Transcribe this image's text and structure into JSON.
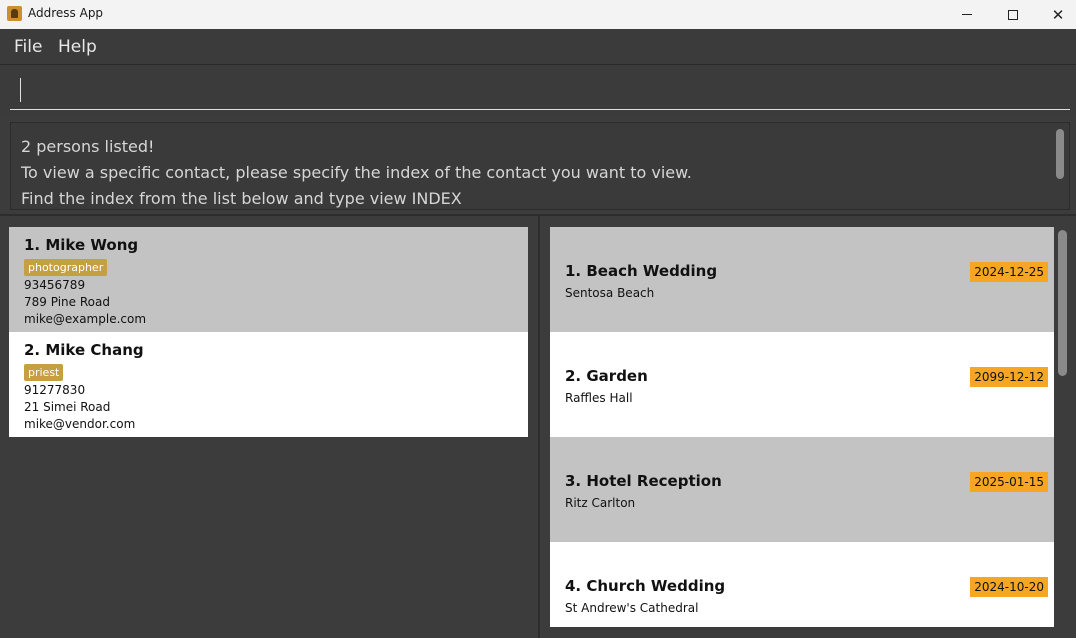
{
  "window": {
    "title": "Address App"
  },
  "menu": {
    "file": "File",
    "help": "Help"
  },
  "command": {
    "value": "",
    "placeholder": ""
  },
  "result": {
    "lines": [
      "2 persons listed!",
      "To view a specific contact, please specify the index of the contact you want to view.",
      "Find the index from the list below and type view INDEX"
    ]
  },
  "persons": [
    {
      "name": "1.  Mike Wong",
      "tag": "photographer",
      "phone": "93456789",
      "address": "789 Pine Road",
      "email": "mike@example.com"
    },
    {
      "name": "2.  Mike Chang",
      "tag": "priest",
      "phone": "91277830",
      "address": "21 Simei Road",
      "email": "mike@vendor.com"
    }
  ],
  "events": [
    {
      "name": "1.  Beach Wedding",
      "location": "Sentosa Beach",
      "date": "2024-12-25"
    },
    {
      "name": "2.  Garden",
      "location": "Raffles Hall",
      "date": "2099-12-12"
    },
    {
      "name": "3.  Hotel Reception",
      "location": "Ritz Carlton",
      "date": "2025-01-15"
    },
    {
      "name": "4.  Church Wedding",
      "location": "St Andrew's Cathedral",
      "date": "2024-10-20"
    }
  ],
  "colors": {
    "selected_card": "#c3c3c3",
    "plain_card": "#ffffff",
    "tag": "#c4a040",
    "date_badge": "#f6a623"
  }
}
